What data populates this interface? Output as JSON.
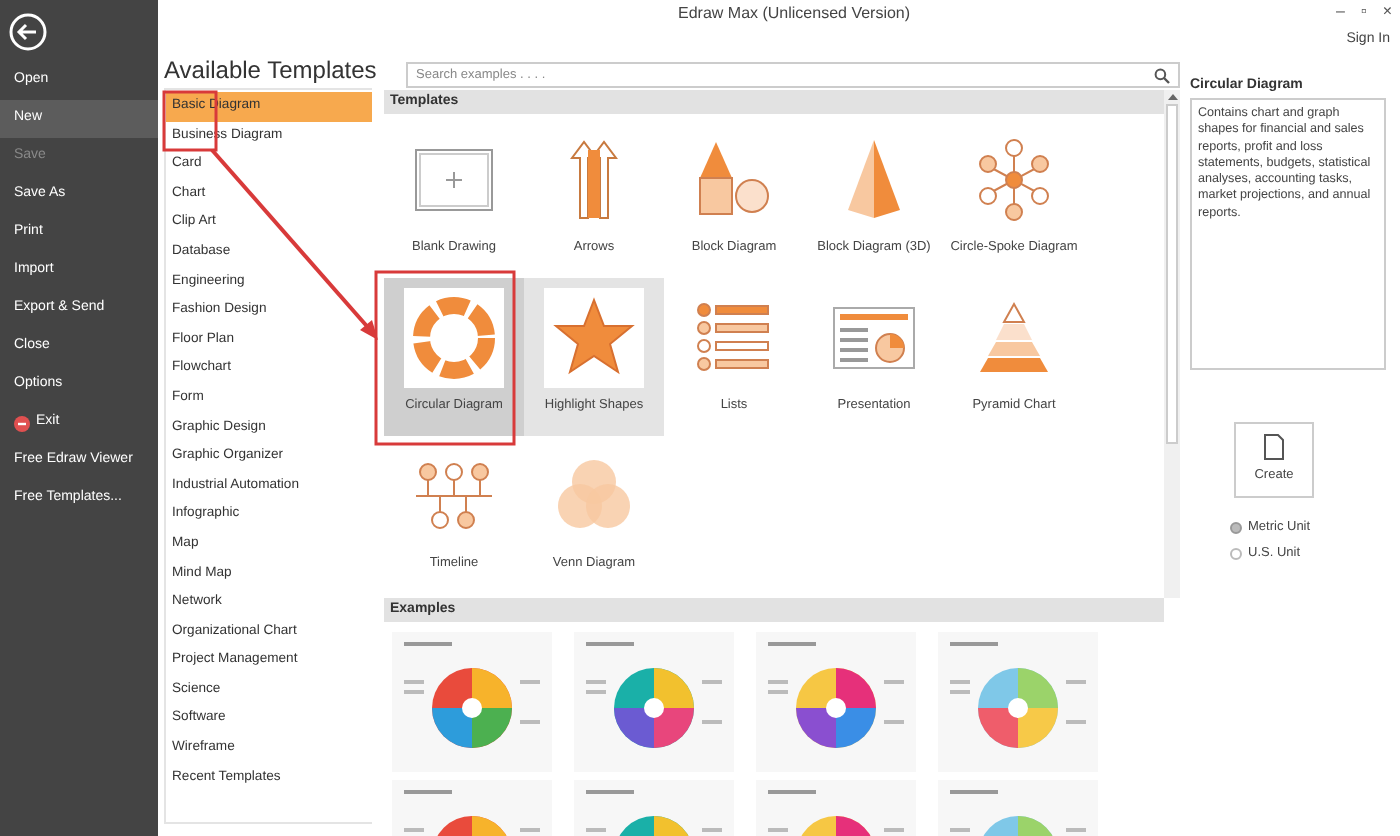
{
  "window": {
    "title": "Edraw Max (Unlicensed Version)",
    "controls": [
      "–",
      "▫",
      "×"
    ],
    "sign_in": "Sign In"
  },
  "sidebar": {
    "items": [
      {
        "label": "Open",
        "selected": false,
        "disabled": false
      },
      {
        "label": "New",
        "selected": true,
        "disabled": false
      },
      {
        "label": "Save",
        "selected": false,
        "disabled": true
      },
      {
        "label": "Save As",
        "selected": false,
        "disabled": false
      },
      {
        "label": "Print",
        "selected": false,
        "disabled": false
      },
      {
        "label": "Import",
        "selected": false,
        "disabled": false
      },
      {
        "label": "Export & Send",
        "selected": false,
        "disabled": false
      },
      {
        "label": "Close",
        "selected": false,
        "disabled": false
      },
      {
        "label": "Options",
        "selected": false,
        "disabled": false
      },
      {
        "label": "Exit",
        "selected": false,
        "disabled": false,
        "kind": "exit"
      },
      {
        "label": "Free Edraw Viewer",
        "selected": false,
        "disabled": false
      },
      {
        "label": "Free Templates...",
        "selected": false,
        "disabled": false
      }
    ]
  },
  "heading": "Available Templates",
  "categories": [
    {
      "label": "Basic Diagram",
      "selected": true
    },
    {
      "label": "Business Diagram",
      "selected": false
    },
    {
      "label": "Card",
      "selected": false
    },
    {
      "label": "Chart",
      "selected": false
    },
    {
      "label": "Clip Art",
      "selected": false
    },
    {
      "label": "Database",
      "selected": false
    },
    {
      "label": "Engineering",
      "selected": false
    },
    {
      "label": "Fashion Design",
      "selected": false
    },
    {
      "label": "Floor Plan",
      "selected": false
    },
    {
      "label": "Flowchart",
      "selected": false
    },
    {
      "label": "Form",
      "selected": false
    },
    {
      "label": "Graphic Design",
      "selected": false
    },
    {
      "label": "Graphic Organizer",
      "selected": false
    },
    {
      "label": "Industrial Automation",
      "selected": false
    },
    {
      "label": "Infographic",
      "selected": false
    },
    {
      "label": "Map",
      "selected": false
    },
    {
      "label": "Mind Map",
      "selected": false
    },
    {
      "label": "Network",
      "selected": false
    },
    {
      "label": "Organizational Chart",
      "selected": false
    },
    {
      "label": "Project Management",
      "selected": false
    },
    {
      "label": "Science",
      "selected": false
    },
    {
      "label": "Software",
      "selected": false
    },
    {
      "label": "Wireframe",
      "selected": false
    },
    {
      "label": "Recent Templates",
      "selected": false
    }
  ],
  "search": {
    "placeholder": "Search examples . . . ."
  },
  "templates": {
    "title": "Templates",
    "items": [
      {
        "label": "Blank Drawing",
        "kind": "blank",
        "selected": false,
        "hovered": false
      },
      {
        "label": "Arrows",
        "kind": "arrows",
        "selected": false,
        "hovered": false
      },
      {
        "label": "Block Diagram",
        "kind": "block",
        "selected": false,
        "hovered": false
      },
      {
        "label": "Block Diagram (3D)",
        "kind": "block3d",
        "selected": false,
        "hovered": false
      },
      {
        "label": "Circle-Spoke Diagram",
        "kind": "spoke",
        "selected": false,
        "hovered": false
      },
      {
        "label": "Circular Diagram",
        "kind": "circular",
        "selected": true,
        "hovered": false
      },
      {
        "label": "Highlight Shapes",
        "kind": "star",
        "selected": false,
        "hovered": true
      },
      {
        "label": "Lists",
        "kind": "lists",
        "selected": false,
        "hovered": false
      },
      {
        "label": "Presentation",
        "kind": "presentation",
        "selected": false,
        "hovered": false
      },
      {
        "label": "Pyramid Chart",
        "kind": "pyramid",
        "selected": false,
        "hovered": false
      },
      {
        "label": "Timeline",
        "kind": "timeline",
        "selected": false,
        "hovered": false
      },
      {
        "label": "Venn Diagram",
        "kind": "venn",
        "selected": false,
        "hovered": false
      }
    ]
  },
  "examples": {
    "title": "Examples"
  },
  "details": {
    "title": "Circular Diagram",
    "description": "Contains chart and graph shapes for financial and sales reports, profit and loss statements, budgets, statistical analyses, accounting tasks, market projections, and annual reports.",
    "create": "Create",
    "units": [
      {
        "label": "Metric Unit",
        "selected": true
      },
      {
        "label": "U.S. Unit",
        "selected": false
      }
    ]
  }
}
